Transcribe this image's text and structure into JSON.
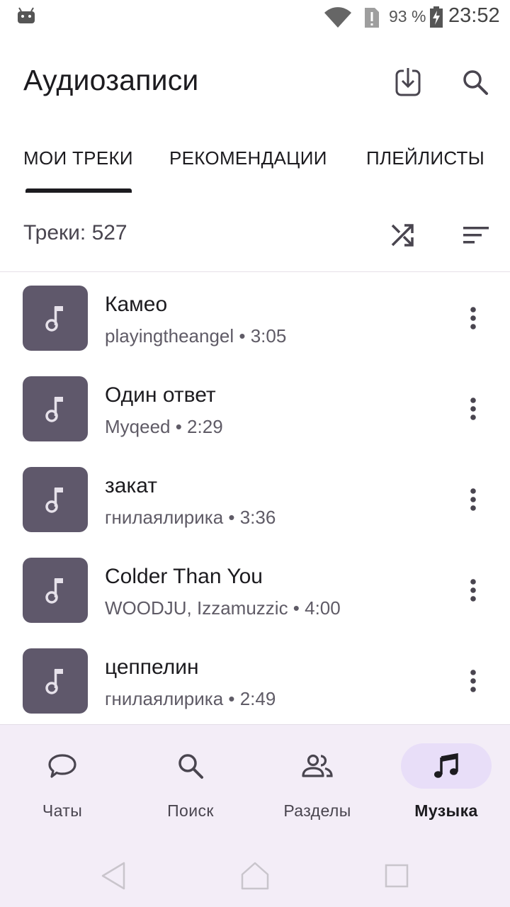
{
  "status_bar": {
    "battery_percent": "93 %",
    "time": "23:52",
    "icons": [
      "android-icon",
      "wifi-icon",
      "sim-alert-icon",
      "battery-charging-icon"
    ]
  },
  "header": {
    "title": "Аудиозаписи",
    "icons": [
      "download-icon",
      "search-icon"
    ]
  },
  "tabs": [
    {
      "label": "МОИ ТРЕКИ",
      "active": true
    },
    {
      "label": "РЕКОМЕНДАЦИИ",
      "active": false
    },
    {
      "label": "ПЛЕЙЛИСТЫ",
      "active": false
    }
  ],
  "toolbar": {
    "count_label": "Треки: 527",
    "icons": [
      "shuffle-icon",
      "sort-icon"
    ]
  },
  "tracks": [
    {
      "title": "Камео",
      "meta": "playingtheangel • 3:05"
    },
    {
      "title": "Один ответ",
      "meta": "Myqeed • 2:29"
    },
    {
      "title": "закат",
      "meta": "гнилаялирика • 3:36"
    },
    {
      "title": "Colder Than You",
      "meta": "WOODJU, Izzamuzzic • 4:00"
    },
    {
      "title": "цеппелин",
      "meta": "гнилаялирика • 2:49"
    }
  ],
  "bottom_nav": [
    {
      "label": "Чаты",
      "icon": "chat-bubble-icon",
      "active": false
    },
    {
      "label": "Поиск",
      "icon": "search-icon",
      "active": false
    },
    {
      "label": "Разделы",
      "icon": "people-icon",
      "active": false
    },
    {
      "label": "Музыка",
      "icon": "music-note-icon",
      "active": true
    }
  ],
  "system_nav": [
    "back-icon",
    "home-icon",
    "recents-icon"
  ],
  "colors": {
    "cover": "#5f586b",
    "nav_background": "#f3edf7",
    "active_pill": "#e8def8",
    "text": "#1c1b1f"
  }
}
